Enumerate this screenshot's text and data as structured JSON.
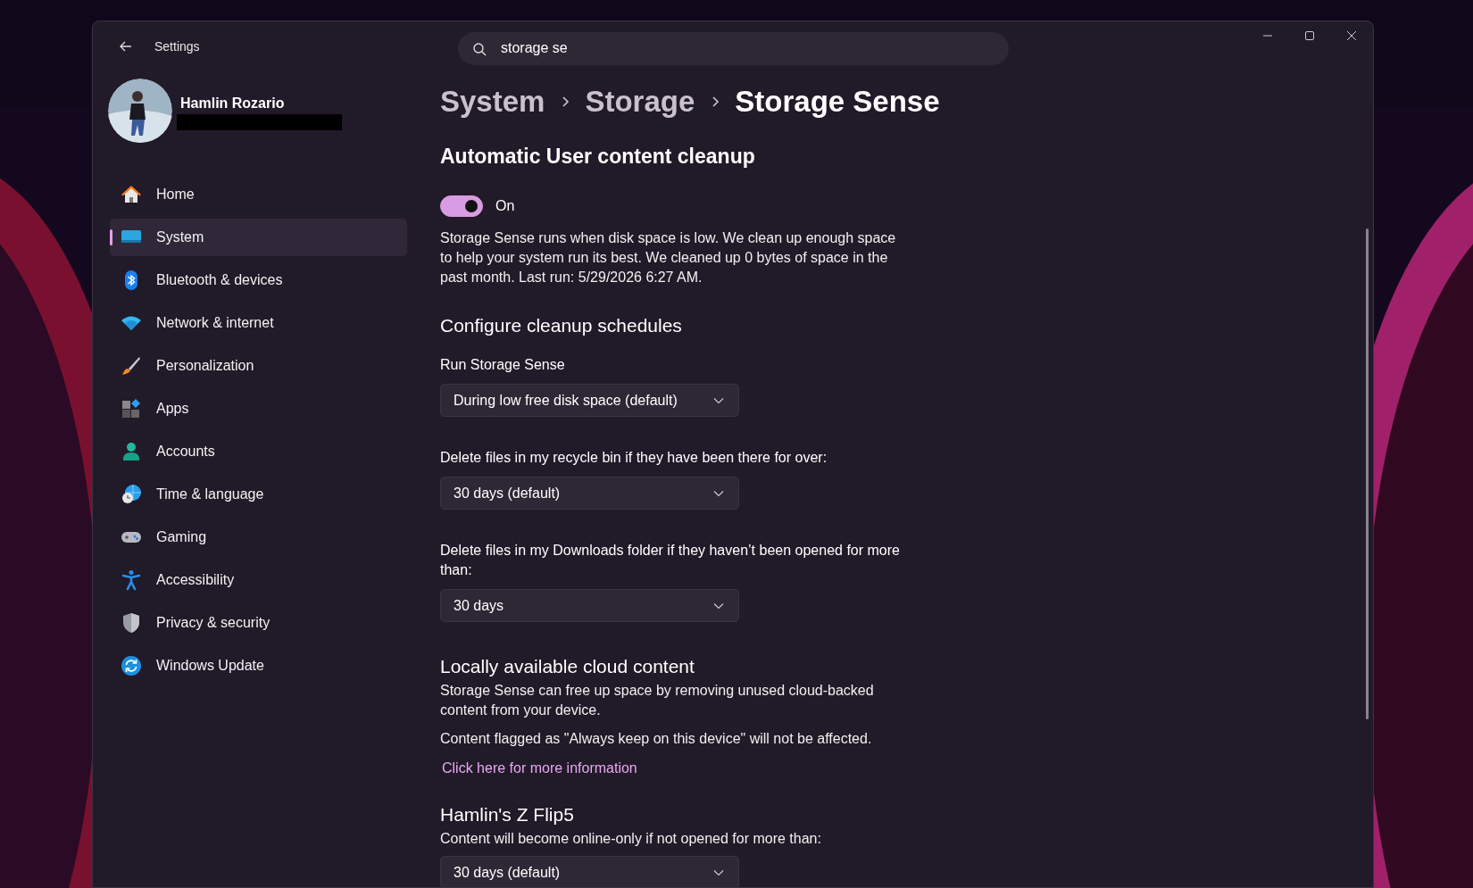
{
  "window": {
    "title": "Settings"
  },
  "search": {
    "value": "storage se"
  },
  "user": {
    "name": "Hamlin Rozario",
    "email_redacted": true
  },
  "sidebar": {
    "items": [
      {
        "label": "Home",
        "kind": "home",
        "selected": false
      },
      {
        "label": "System",
        "kind": "system",
        "selected": true
      },
      {
        "label": "Bluetooth & devices",
        "kind": "bluetooth",
        "selected": false
      },
      {
        "label": "Network & internet",
        "kind": "network",
        "selected": false
      },
      {
        "label": "Personalization",
        "kind": "brush",
        "selected": false
      },
      {
        "label": "Apps",
        "kind": "apps",
        "selected": false
      },
      {
        "label": "Accounts",
        "kind": "accounts",
        "selected": false
      },
      {
        "label": "Time & language",
        "kind": "time",
        "selected": false
      },
      {
        "label": "Gaming",
        "kind": "gaming",
        "selected": false
      },
      {
        "label": "Accessibility",
        "kind": "accessibility",
        "selected": false
      },
      {
        "label": "Privacy & security",
        "kind": "privacy",
        "selected": false
      },
      {
        "label": "Windows Update",
        "kind": "update",
        "selected": false
      }
    ]
  },
  "breadcrumb": [
    "System",
    "Storage",
    "Storage Sense"
  ],
  "content": [
    {
      "kind": "heading",
      "text": "Automatic User content cleanup"
    },
    {
      "kind": "toggle",
      "on": true,
      "label": "On"
    },
    {
      "kind": "paragraph",
      "text": "Storage Sense runs when disk space is low. We clean up enough space to help your system run its best. We cleaned up 0 bytes of space in the past month. Last run: 5/29/2026 6:27 AM."
    },
    {
      "kind": "subheading",
      "text": "Configure cleanup schedules"
    },
    {
      "kind": "label",
      "text": "Run Storage Sense"
    },
    {
      "kind": "dropdown",
      "value": "During low free disk space (default)"
    },
    {
      "kind": "label",
      "text": "Delete files in my recycle bin if they have been there for over:"
    },
    {
      "kind": "dropdown",
      "value": "30 days (default)"
    },
    {
      "kind": "label",
      "text": "Delete files in my Downloads folder if they haven’t been opened for more than:"
    },
    {
      "kind": "dropdown",
      "value": "30 days"
    },
    {
      "kind": "subheading",
      "text": "Locally available cloud content"
    },
    {
      "kind": "paragraph",
      "text": "Storage Sense can free up space by removing unused cloud-backed content from your device."
    },
    {
      "kind": "paragraph",
      "text": "Content flagged as \"Always keep on this device\" will not be affected."
    },
    {
      "kind": "link",
      "text": "Click here for more information"
    },
    {
      "kind": "subheading",
      "text": "Hamlin's Z Flip5"
    },
    {
      "kind": "paragraph",
      "text": "Content will become online-only if not opened for more than:"
    },
    {
      "kind": "dropdown",
      "value": "30 days (default)"
    }
  ]
}
